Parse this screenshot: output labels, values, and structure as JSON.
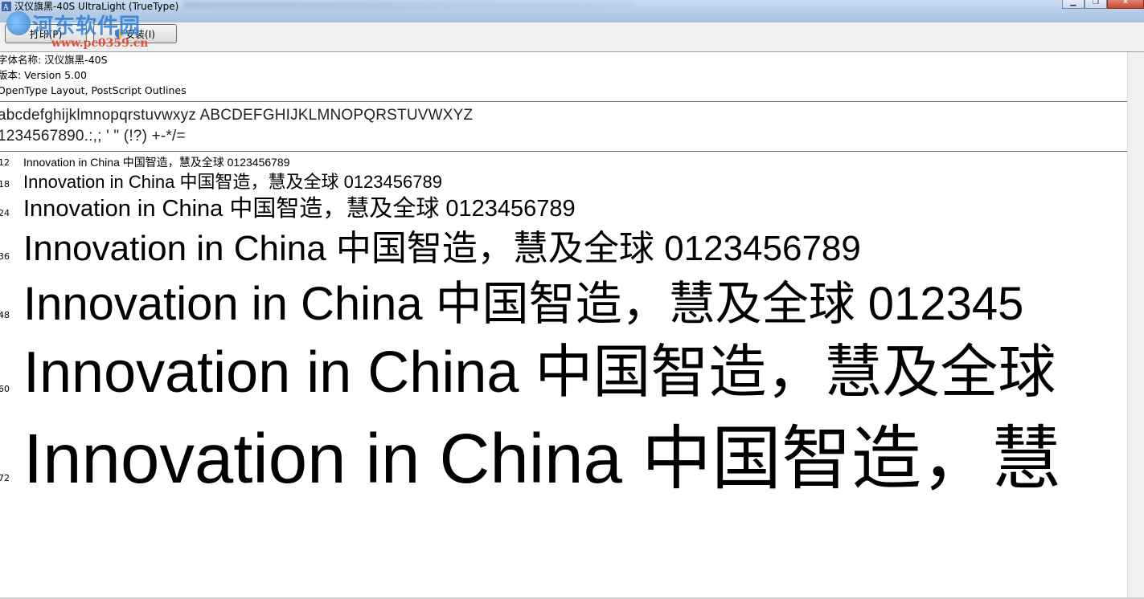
{
  "window": {
    "title": "汉仪旗黑-40S UltraLight (TrueType)"
  },
  "watermark": {
    "title": "河东软件园",
    "url": "www.pc0359.cn"
  },
  "toolbar": {
    "print_label": "打印(P)",
    "install_label": "安装(I)"
  },
  "font_info": {
    "name_line": "字体名称: 汉仪旗黑-40S",
    "version_line": "版本: Version 5.00",
    "outline_line": "OpenType Layout, PostScript Outlines"
  },
  "character_set": {
    "letters": "abcdefghijklmnopqrstuvwxyz ABCDEFGHIJKLMNOPQRSTUVWXYZ",
    "digits": "1234567890.:,; ' \" (!?) +-*/="
  },
  "samples": [
    {
      "size": "12",
      "text": "Innovation in China 中国智造，慧及全球 0123456789"
    },
    {
      "size": "18",
      "text": "Innovation in China 中国智造，慧及全球 0123456789"
    },
    {
      "size": "24",
      "text": "Innovation in China 中国智造，慧及全球 0123456789"
    },
    {
      "size": "36",
      "text": "Innovation in China 中国智造，慧及全球 0123456789"
    },
    {
      "size": "48",
      "text": "Innovation in China 中国智造，慧及全球 012345"
    },
    {
      "size": "60",
      "text": "Innovation in China 中国智造，慧及全球"
    },
    {
      "size": "72",
      "text": "Innovation in China 中国智造，慧"
    }
  ],
  "colors": {
    "titlebar": "#b4cbe6",
    "toolbar": "#f0f0f0",
    "separator": "#6e6e6e",
    "watermark_blue": "#2d7fd8",
    "watermark_red": "#e1402a"
  }
}
